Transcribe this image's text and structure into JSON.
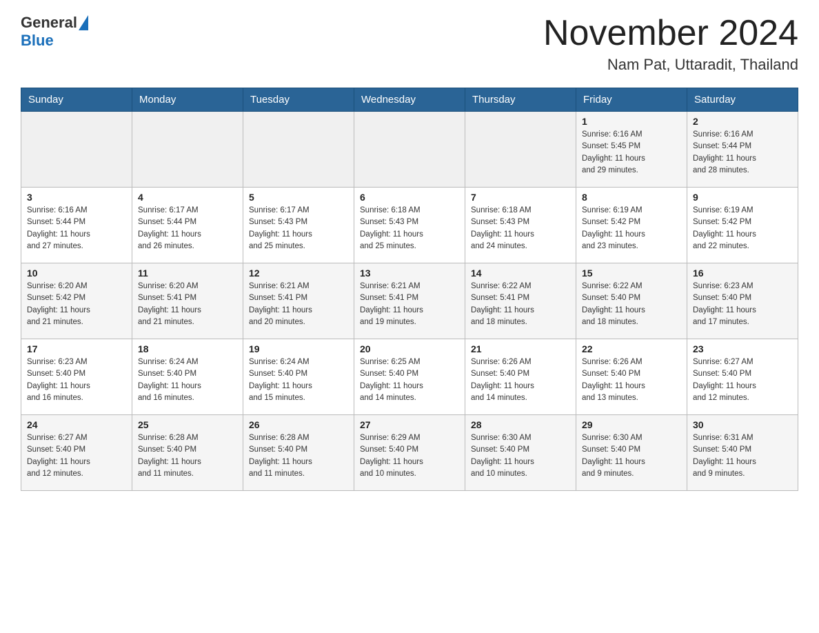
{
  "header": {
    "logo_general": "General",
    "logo_blue": "Blue",
    "month_year": "November 2024",
    "location": "Nam Pat, Uttaradit, Thailand"
  },
  "days_of_week": [
    "Sunday",
    "Monday",
    "Tuesday",
    "Wednesday",
    "Thursday",
    "Friday",
    "Saturday"
  ],
  "weeks": [
    [
      {
        "day": "",
        "info": ""
      },
      {
        "day": "",
        "info": ""
      },
      {
        "day": "",
        "info": ""
      },
      {
        "day": "",
        "info": ""
      },
      {
        "day": "",
        "info": ""
      },
      {
        "day": "1",
        "info": "Sunrise: 6:16 AM\nSunset: 5:45 PM\nDaylight: 11 hours\nand 29 minutes."
      },
      {
        "day": "2",
        "info": "Sunrise: 6:16 AM\nSunset: 5:44 PM\nDaylight: 11 hours\nand 28 minutes."
      }
    ],
    [
      {
        "day": "3",
        "info": "Sunrise: 6:16 AM\nSunset: 5:44 PM\nDaylight: 11 hours\nand 27 minutes."
      },
      {
        "day": "4",
        "info": "Sunrise: 6:17 AM\nSunset: 5:44 PM\nDaylight: 11 hours\nand 26 minutes."
      },
      {
        "day": "5",
        "info": "Sunrise: 6:17 AM\nSunset: 5:43 PM\nDaylight: 11 hours\nand 25 minutes."
      },
      {
        "day": "6",
        "info": "Sunrise: 6:18 AM\nSunset: 5:43 PM\nDaylight: 11 hours\nand 25 minutes."
      },
      {
        "day": "7",
        "info": "Sunrise: 6:18 AM\nSunset: 5:43 PM\nDaylight: 11 hours\nand 24 minutes."
      },
      {
        "day": "8",
        "info": "Sunrise: 6:19 AM\nSunset: 5:42 PM\nDaylight: 11 hours\nand 23 minutes."
      },
      {
        "day": "9",
        "info": "Sunrise: 6:19 AM\nSunset: 5:42 PM\nDaylight: 11 hours\nand 22 minutes."
      }
    ],
    [
      {
        "day": "10",
        "info": "Sunrise: 6:20 AM\nSunset: 5:42 PM\nDaylight: 11 hours\nand 21 minutes."
      },
      {
        "day": "11",
        "info": "Sunrise: 6:20 AM\nSunset: 5:41 PM\nDaylight: 11 hours\nand 21 minutes."
      },
      {
        "day": "12",
        "info": "Sunrise: 6:21 AM\nSunset: 5:41 PM\nDaylight: 11 hours\nand 20 minutes."
      },
      {
        "day": "13",
        "info": "Sunrise: 6:21 AM\nSunset: 5:41 PM\nDaylight: 11 hours\nand 19 minutes."
      },
      {
        "day": "14",
        "info": "Sunrise: 6:22 AM\nSunset: 5:41 PM\nDaylight: 11 hours\nand 18 minutes."
      },
      {
        "day": "15",
        "info": "Sunrise: 6:22 AM\nSunset: 5:40 PM\nDaylight: 11 hours\nand 18 minutes."
      },
      {
        "day": "16",
        "info": "Sunrise: 6:23 AM\nSunset: 5:40 PM\nDaylight: 11 hours\nand 17 minutes."
      }
    ],
    [
      {
        "day": "17",
        "info": "Sunrise: 6:23 AM\nSunset: 5:40 PM\nDaylight: 11 hours\nand 16 minutes."
      },
      {
        "day": "18",
        "info": "Sunrise: 6:24 AM\nSunset: 5:40 PM\nDaylight: 11 hours\nand 16 minutes."
      },
      {
        "day": "19",
        "info": "Sunrise: 6:24 AM\nSunset: 5:40 PM\nDaylight: 11 hours\nand 15 minutes."
      },
      {
        "day": "20",
        "info": "Sunrise: 6:25 AM\nSunset: 5:40 PM\nDaylight: 11 hours\nand 14 minutes."
      },
      {
        "day": "21",
        "info": "Sunrise: 6:26 AM\nSunset: 5:40 PM\nDaylight: 11 hours\nand 14 minutes."
      },
      {
        "day": "22",
        "info": "Sunrise: 6:26 AM\nSunset: 5:40 PM\nDaylight: 11 hours\nand 13 minutes."
      },
      {
        "day": "23",
        "info": "Sunrise: 6:27 AM\nSunset: 5:40 PM\nDaylight: 11 hours\nand 12 minutes."
      }
    ],
    [
      {
        "day": "24",
        "info": "Sunrise: 6:27 AM\nSunset: 5:40 PM\nDaylight: 11 hours\nand 12 minutes."
      },
      {
        "day": "25",
        "info": "Sunrise: 6:28 AM\nSunset: 5:40 PM\nDaylight: 11 hours\nand 11 minutes."
      },
      {
        "day": "26",
        "info": "Sunrise: 6:28 AM\nSunset: 5:40 PM\nDaylight: 11 hours\nand 11 minutes."
      },
      {
        "day": "27",
        "info": "Sunrise: 6:29 AM\nSunset: 5:40 PM\nDaylight: 11 hours\nand 10 minutes."
      },
      {
        "day": "28",
        "info": "Sunrise: 6:30 AM\nSunset: 5:40 PM\nDaylight: 11 hours\nand 10 minutes."
      },
      {
        "day": "29",
        "info": "Sunrise: 6:30 AM\nSunset: 5:40 PM\nDaylight: 11 hours\nand 9 minutes."
      },
      {
        "day": "30",
        "info": "Sunrise: 6:31 AM\nSunset: 5:40 PM\nDaylight: 11 hours\nand 9 minutes."
      }
    ]
  ]
}
